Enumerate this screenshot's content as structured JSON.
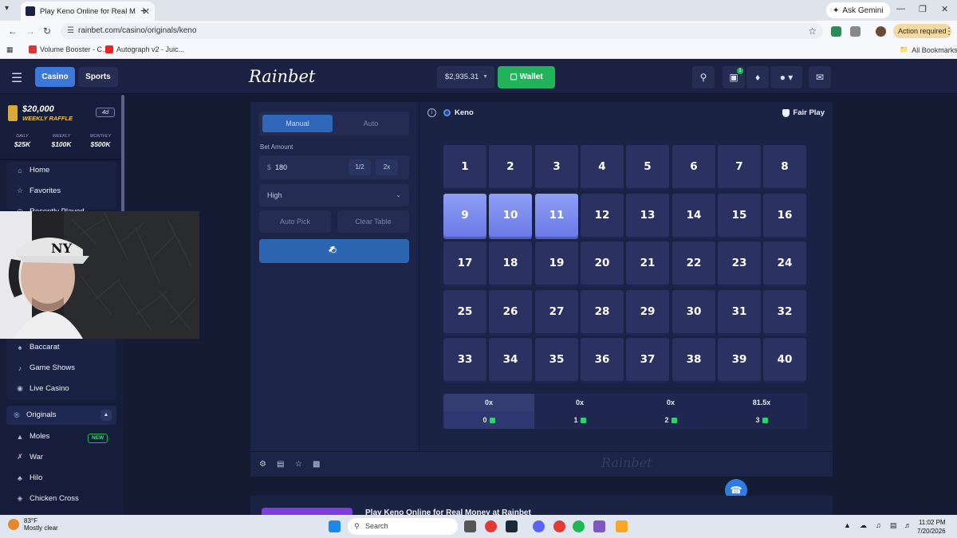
{
  "browser": {
    "tab_title": "Play Keno Online for Real M",
    "ask_gemini": "Ask Gemini",
    "url": "rainbet.com/casino/originals/keno",
    "action_required": "Action required",
    "bookmarks": [
      "Volume Booster - C...",
      "Autograph v2 - Juic...",
      "All Bookmarks"
    ]
  },
  "header": {
    "casino": "Casino",
    "sports": "Sports",
    "logo": "Rainbet",
    "balance": "$2,935.31",
    "wallet": "Wallet",
    "gift_count": "1"
  },
  "sidebar": {
    "raffle_amount": "$20,000",
    "raffle_label": "WEEKLY RAFFLE",
    "raffle_days": "4d",
    "raffle_tiers": [
      {
        "label": "DAILY",
        "value": "$25K"
      },
      {
        "label": "WEEKLY",
        "value": "$100K"
      },
      {
        "label": "MONTHLY",
        "value": "$500K"
      }
    ],
    "items": [
      "Home",
      "Favorites",
      "Recently Played"
    ],
    "lower_items": [
      "Baccarat",
      "Game Shows",
      "Live Casino"
    ],
    "originals": "Originals",
    "originals_items": [
      "Moles",
      "War",
      "Hilo",
      "Chicken Cross"
    ],
    "new_badge": "NEW"
  },
  "controls": {
    "manual": "Manual",
    "auto": "Auto",
    "bet_label": "Bet Amount",
    "currency": "$",
    "bet_value": "180",
    "half": "1/2",
    "double": "2x",
    "risk": "High",
    "auto_pick": "Auto Pick",
    "clear_table": "Clear Table"
  },
  "board": {
    "game_title": "Keno",
    "fair_play": "Fair Play",
    "tiles": [
      "1",
      "2",
      "3",
      "4",
      "5",
      "6",
      "7",
      "8",
      "9",
      "10",
      "11",
      "12",
      "13",
      "14",
      "15",
      "16",
      "17",
      "18",
      "19",
      "20",
      "21",
      "22",
      "23",
      "24",
      "25",
      "26",
      "27",
      "28",
      "29",
      "30",
      "31",
      "32",
      "33",
      "34",
      "35",
      "36",
      "37",
      "38",
      "39",
      "40"
    ],
    "selected": [
      "9",
      "10",
      "11"
    ],
    "payouts": [
      "0x",
      "0x",
      "0x",
      "81.5x"
    ],
    "hits": [
      "0",
      "1",
      "2",
      "3"
    ]
  },
  "footer": {
    "logo": "Rainbet"
  },
  "below": {
    "title": "Play Keno Online for Real Money at Rainbet"
  },
  "taskbar": {
    "temp": "83°F",
    "weather": "Mostly clear",
    "search": "Search",
    "time": "11:02 PM",
    "date": "7/20/2026"
  }
}
